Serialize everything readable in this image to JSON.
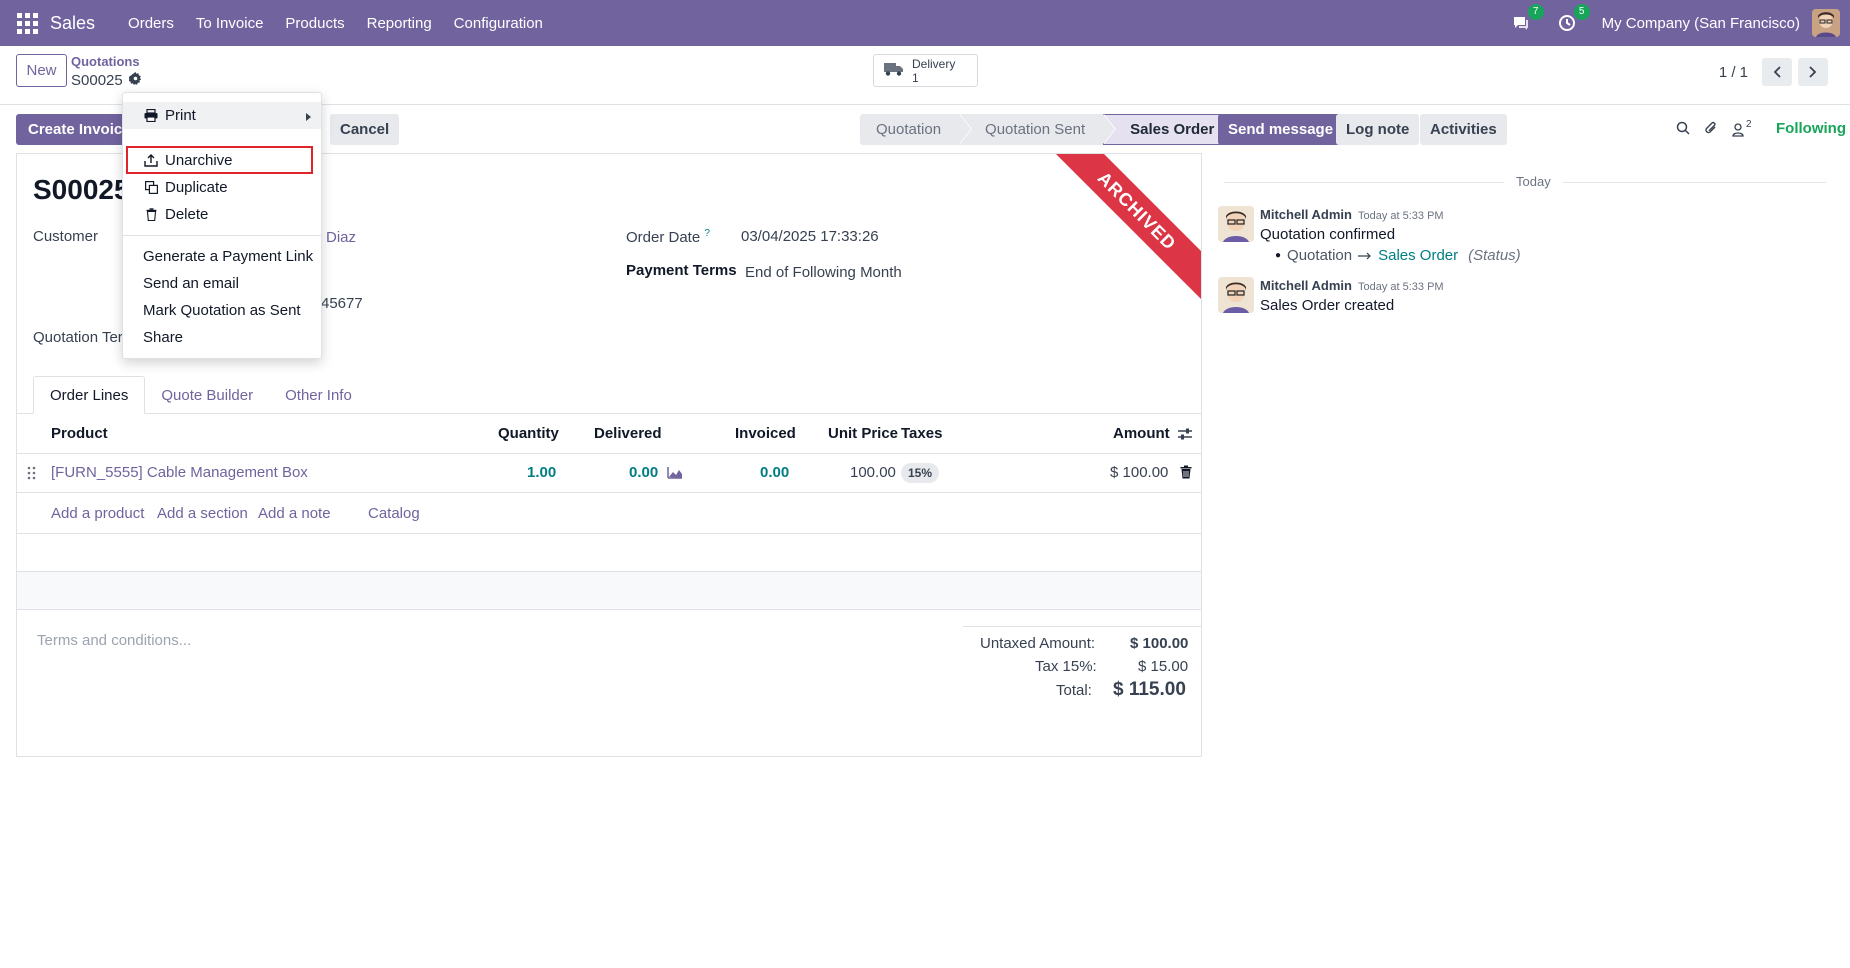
{
  "navbar": {
    "app_name": "Sales",
    "menu": [
      "Orders",
      "To Invoice",
      "Products",
      "Reporting",
      "Configuration"
    ],
    "messages_badge": "7",
    "activities_badge": "5",
    "company": "My Company (San Francisco)",
    "accent_color": "#71639e"
  },
  "control_panel": {
    "new_label": "New",
    "breadcrumb_parent": "Quotations",
    "breadcrumb_current": "S00025",
    "smart_button": {
      "label": "Delivery",
      "count": "1"
    },
    "pager": "1 / 1"
  },
  "actions": {
    "create_invoice": "Create Invoice",
    "cancel": "Cancel"
  },
  "statusbar": {
    "stages": [
      "Quotation",
      "Quotation Sent",
      "Sales Order"
    ],
    "active": "Sales Order"
  },
  "form": {
    "ribbon": "ARCHIVED",
    "name": "S00025",
    "customer_label": "Customer",
    "customer_value_fragment": "Diaz",
    "customer_address_fragment": "45677",
    "quotation_template_label": "Quotation Ter",
    "order_date_label": "Order Date",
    "order_date_help": "?",
    "order_date_value": "03/04/2025 17:33:26",
    "payment_terms_label": "Payment Terms",
    "payment_terms_value": "End of Following Month"
  },
  "tabs": [
    "Order Lines",
    "Quote Builder",
    "Other Info"
  ],
  "order_lines": {
    "headers": {
      "product": "Product",
      "quantity": "Quantity",
      "delivered": "Delivered",
      "invoiced": "Invoiced",
      "unit_price": "Unit Price",
      "taxes": "Taxes",
      "amount": "Amount"
    },
    "rows": [
      {
        "product": "[FURN_5555] Cable Management Box",
        "quantity": "1.00",
        "delivered": "0.00",
        "invoiced": "0.00",
        "unit_price": "100.00",
        "tax": "15%",
        "amount": "$ 100.00"
      }
    ],
    "add_links": [
      "Add a product",
      "Add a section",
      "Add a note",
      "Catalog"
    ]
  },
  "footer": {
    "terms_placeholder": "Terms and conditions...",
    "untaxed_label": "Untaxed Amount:",
    "untaxed_value": "$ 100.00",
    "tax_label": "Tax 15%:",
    "tax_value": "$ 15.00",
    "total_label": "Total:",
    "total_value": "$ 115.00"
  },
  "chatter": {
    "send_message": "Send message",
    "log_note": "Log note",
    "activities": "Activities",
    "followers_count": "2",
    "following": "Following",
    "day": "Today",
    "messages": [
      {
        "author": "Mitchell Admin",
        "time": "Today at 5:33 PM",
        "body": "Quotation confirmed",
        "change_from": "Quotation",
        "change_to": "Sales Order",
        "field": "(Status)"
      },
      {
        "author": "Mitchell Admin",
        "time": "Today at 5:33 PM",
        "body": "Sales Order created"
      }
    ]
  },
  "gear_menu": {
    "print": "Print",
    "unarchive": "Unarchive",
    "duplicate": "Duplicate",
    "delete": "Delete",
    "extra": [
      "Generate a Payment Link",
      "Send an email",
      "Mark Quotation as Sent",
      "Share"
    ]
  }
}
